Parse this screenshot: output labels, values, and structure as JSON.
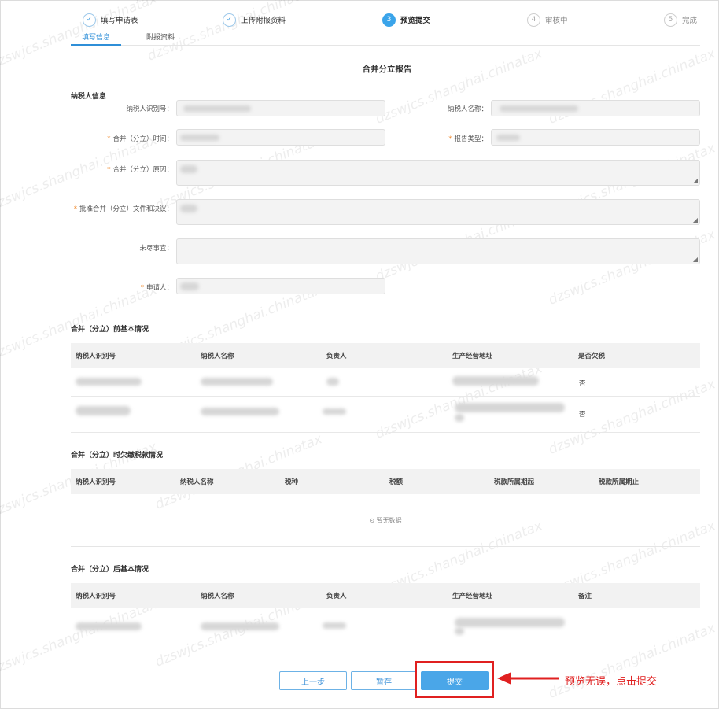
{
  "steps": [
    {
      "label": "填写申请表",
      "status": "done"
    },
    {
      "label": "上传附报资料",
      "status": "done"
    },
    {
      "label": "预览提交",
      "status": "active",
      "num": "3"
    },
    {
      "label": "审核中",
      "status": "pending",
      "num": "4"
    },
    {
      "label": "完成",
      "status": "pending",
      "num": "5"
    }
  ],
  "tabs": [
    {
      "label": "填写信息",
      "active": true
    },
    {
      "label": "附报资料",
      "active": false
    }
  ],
  "report_title": "合并分立报告",
  "taxpayer_info": {
    "section_title": "纳税人信息",
    "taxpayer_id_label": "纳税人识别号：",
    "taxpayer_name_label": "纳税人名称：",
    "merge_time_label": "合并（分立）时间：",
    "report_type_label": "报告类型：",
    "reason_label": "合并（分立）原因：",
    "approval_doc_label": "批准合并（分立）文件和决议：",
    "pending_items_label": "未尽事宜：",
    "applicant_label": "申请人："
  },
  "before_table": {
    "section_title": "合并（分立）前基本情况",
    "headers": [
      "纳税人识别号",
      "纳税人名称",
      "负责人",
      "生产经营地址",
      "是否欠税"
    ],
    "rows": [
      {
        "tax_arrears": "否"
      },
      {
        "tax_arrears": "否"
      }
    ]
  },
  "arrears_table": {
    "section_title": "合并（分立）时欠缴税款情况",
    "headers": [
      "纳税人识别号",
      "纳税人名称",
      "税种",
      "税额",
      "税款所属期起",
      "税款所属期止"
    ],
    "empty_text": "暂无数据"
  },
  "after_table": {
    "section_title": "合并（分立）后基本情况",
    "headers": [
      "纳税人识别号",
      "纳税人名称",
      "负责人",
      "生产经营地址",
      "备注"
    ]
  },
  "buttons": {
    "prev": "上一步",
    "save": "暂存",
    "submit": "提交"
  },
  "annotation": "预览无误，点击提交",
  "watermark": "dzswjcs.shanghai.chinatax",
  "colors": {
    "accent": "#3aa4ea",
    "annotation": "#e02020",
    "required": "#f08a2e"
  }
}
